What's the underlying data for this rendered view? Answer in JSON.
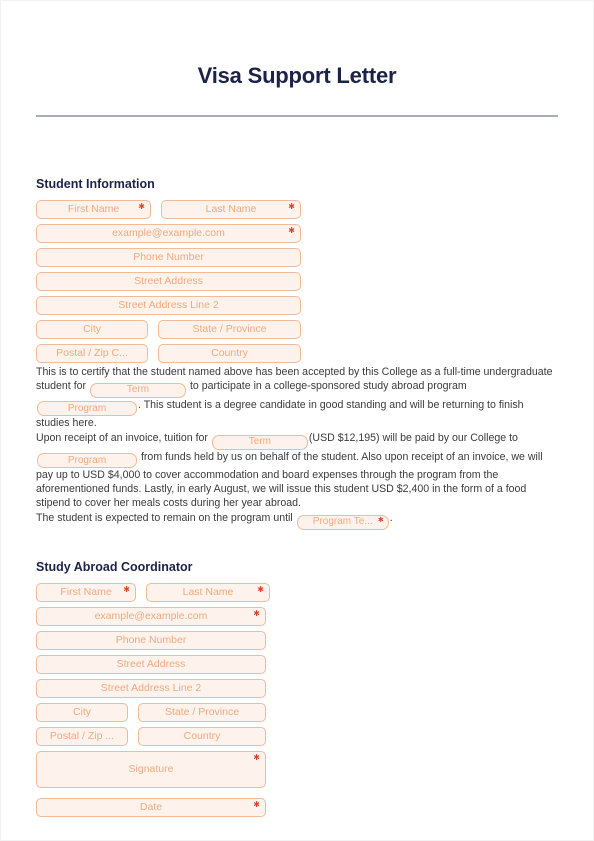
{
  "document": {
    "title": "Visa Support Letter"
  },
  "student_section": {
    "heading": "Student Information",
    "fields": [
      {
        "name": "first-name",
        "placeholder": "First Name",
        "required": true
      },
      {
        "name": "last-name",
        "placeholder": "Last Name",
        "required": true
      },
      {
        "name": "email",
        "placeholder": "example@example.com",
        "required": true
      },
      {
        "name": "phone-number",
        "placeholder": "Phone Number",
        "required": false
      },
      {
        "name": "street-address",
        "placeholder": "Street Address",
        "required": false
      },
      {
        "name": "street-address-line-2",
        "placeholder": "Street Address Line 2",
        "required": false
      },
      {
        "name": "city",
        "placeholder": "City",
        "required": false
      },
      {
        "name": "state-province",
        "placeholder": "State / Province",
        "required": false
      },
      {
        "name": "postal-zip-code",
        "placeholder": "Postal / Zip C...",
        "required": false
      },
      {
        "name": "country",
        "placeholder": "Country",
        "required": false
      }
    ]
  },
  "body": {
    "paragraph_1": {
      "part_1": "This is to certify that the student named above has been accepted by this College as a full-time undergraduate student for",
      "term_placeholder": "Term",
      "part_2": "to participate in a college-sponsored study abroad program",
      "program_placeholder": "Program",
      "part_3": ". This student is a degree candidate in good standing and will be returning to finish studies here."
    },
    "paragraph_2": {
      "part_1": "Upon receipt of an invoice, tuition for",
      "term_placeholder": "Term",
      "part_2": "(USD $12,195) will be paid by our College to",
      "program_placeholder": "Program",
      "part_3": "from funds held by us on behalf of the student. Also upon receipt of an invoice, we will pay up to USD $4,000 to cover accommodation and board expenses through the program from the aforementioned funds. Lastly, in early August, we will issue this student USD $2,400 in the form of a food stipend to cover her meals costs during her year abroad."
    },
    "paragraph_3": {
      "part_1": "The student is expected to remain on the program until",
      "program_term_placeholder": "Program Te...",
      "part_2": "."
    }
  },
  "coordinator_section": {
    "heading": "Study Abroad Coordinator",
    "fields": [
      {
        "name": "first-name",
        "placeholder": "First Name",
        "required": true
      },
      {
        "name": "last-name",
        "placeholder": "Last Name",
        "required": true
      },
      {
        "name": "email",
        "placeholder": "example@example.com",
        "required": true
      },
      {
        "name": "phone-number",
        "placeholder": "Phone Number",
        "required": false
      },
      {
        "name": "street-address",
        "placeholder": "Street Address",
        "required": false
      },
      {
        "name": "street-address-line-2",
        "placeholder": "Street Address Line 2",
        "required": false
      },
      {
        "name": "city",
        "placeholder": "City",
        "required": false
      },
      {
        "name": "state-province",
        "placeholder": "State / Province",
        "required": false
      },
      {
        "name": "postal-zip-code",
        "placeholder": "Postal / Zip ...",
        "required": false
      },
      {
        "name": "country",
        "placeholder": "Country",
        "required": false
      },
      {
        "name": "signature",
        "placeholder": "Signature",
        "required": true
      },
      {
        "name": "date",
        "placeholder": "Date",
        "required": true
      }
    ]
  },
  "colors": {
    "title": "#1d2248",
    "rule": "#a9adbb",
    "field_fill": "#fdf3ec",
    "field_border": "#f2bb98",
    "placeholder": "#f0a97e",
    "required_asterisk": "#d9452a",
    "body_text": "#3b3b3b"
  }
}
